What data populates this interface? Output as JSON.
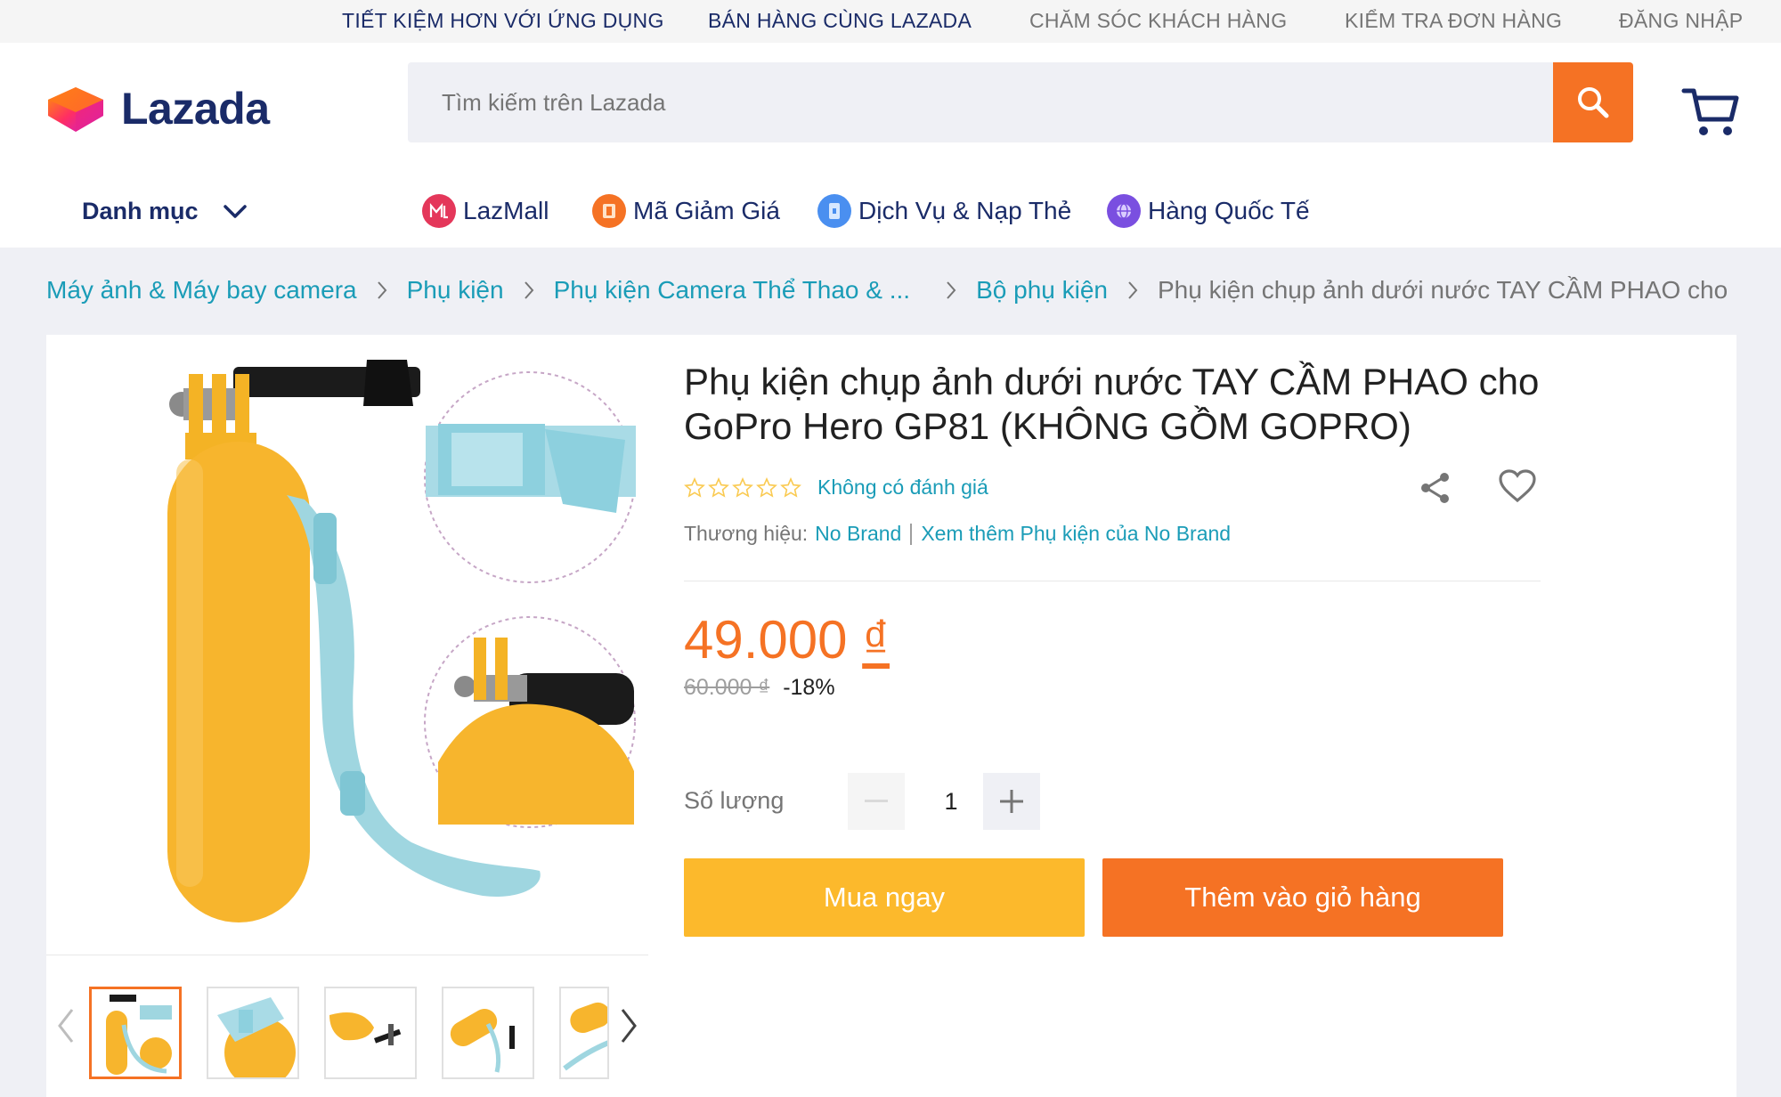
{
  "topbar": {
    "links": [
      "TIẾT KIỆM HƠN VỚI ỨNG DỤNG",
      "BÁN HÀNG CÙNG LAZADA",
      "CHĂM SÓC KHÁCH HÀNG",
      "KIỂM TRA ĐƠN HÀNG",
      "ĐĂNG NHẬP"
    ]
  },
  "header": {
    "logo_text": "Lazada",
    "search_placeholder": "Tìm kiếm trên Lazada",
    "category_label": "Danh mục",
    "nav": [
      {
        "label": "LazMall",
        "icon": "lazmall-icon",
        "color": "#e4375a"
      },
      {
        "label": "Mã Giảm Giá",
        "icon": "voucher-icon",
        "color": "#f57224"
      },
      {
        "label": "Dịch Vụ & Nạp Thẻ",
        "icon": "topup-icon",
        "color": "#4a8ff0"
      },
      {
        "label": "Hàng Quốc Tế",
        "icon": "global-icon",
        "color": "#7a4fe0"
      }
    ]
  },
  "breadcrumb": [
    "Máy ảnh & Máy bay camera",
    "Phụ kiện",
    "Phụ kiện Camera Thể Thao & ...",
    "Bộ phụ kiện",
    "Phụ kiện chụp ảnh dưới nước TAY CẦM PHAO cho"
  ],
  "product": {
    "title": "Phụ kiện chụp ảnh dưới nước TAY CẦM PHAO cho GoPro Hero GP81 (KHÔNG GỒM GOPRO)",
    "rating_text": "Không có đánh giá",
    "rating_value": 0,
    "rating_max": 5,
    "brand_label": "Thương hiệu:",
    "brand": "No Brand",
    "brand_more": "Xem thêm Phụ kiện của No Brand",
    "price_amount": "49.000",
    "price_currency": "₫",
    "old_price": "60.000 ₫",
    "discount": "-18%",
    "quantity_label": "Số lượng",
    "quantity": "1",
    "buy_now": "Mua ngay",
    "add_to_cart": "Thêm vào giỏ hàng"
  },
  "colors": {
    "brand_orange": "#f57224",
    "buy_yellow": "#fcb92c",
    "link_blue": "#1a9cb7",
    "nav_navy": "#1a2b68"
  }
}
